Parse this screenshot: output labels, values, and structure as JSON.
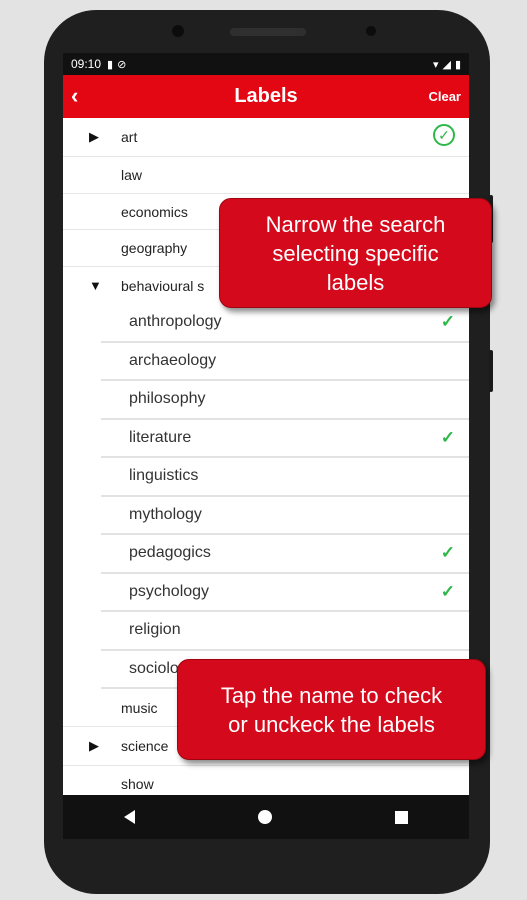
{
  "status_bar": {
    "time": "09:10"
  },
  "app_bar": {
    "title": "Labels",
    "back_glyph": "‹",
    "clear_label": "Clear"
  },
  "labels": {
    "art": "art",
    "law": "law",
    "economics": "economics",
    "geography": "geography",
    "behavioural": "behavioural s",
    "anthropology": "anthropology",
    "archaeology": "archaeology",
    "philosophy": "philosophy",
    "literature": "literature",
    "linguistics": "linguistics",
    "mythology": "mythology",
    "pedagogics": "pedagogics",
    "psychology": "psychology",
    "religion": "religion",
    "sociology": "sociolo",
    "music": "music",
    "science": "science",
    "show": "show"
  },
  "checked": [
    "art",
    "anthropology",
    "literature",
    "pedagogics",
    "psychology"
  ],
  "callouts": {
    "narrow": "Narrow the search\nselecting specific\nlabels",
    "tap": "Tap the name to check\nor unckeck the labels"
  },
  "colors": {
    "accent": "#e30613",
    "check": "#2fb84a"
  }
}
